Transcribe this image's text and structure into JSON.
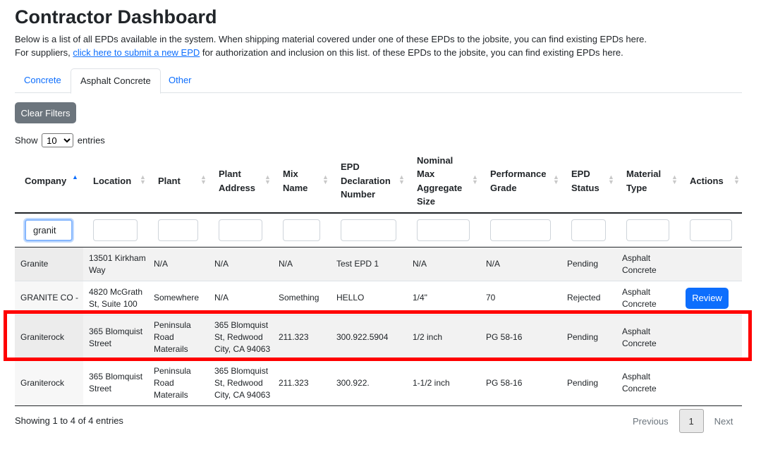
{
  "header": {
    "title": "Contractor Dashboard",
    "desc_line1": "Below is a list of all EPDs available in the system. When shipping material covered under one of these EPDs to the jobsite, you can find existing EPDs here.",
    "desc_line2_pre": "For suppliers, ",
    "desc_link": "click here to submit a new EPD",
    "desc_line2_post": " for authorization and inclusion on this list. of these EPDs to the jobsite, you can find existing EPDs here."
  },
  "tabs": [
    {
      "label": "Concrete",
      "active": false
    },
    {
      "label": "Asphalt Concrete",
      "active": true
    },
    {
      "label": "Other",
      "active": false
    }
  ],
  "toolbar": {
    "clear_filters": "Clear Filters",
    "show_label": "Show",
    "entries_value": "10",
    "entries_label": "entries"
  },
  "columns": [
    {
      "label": "Company",
      "sorted": "asc"
    },
    {
      "label": "Location"
    },
    {
      "label": "Plant"
    },
    {
      "label": "Plant Address"
    },
    {
      "label": "Mix Name"
    },
    {
      "label": "EPD Declaration Number"
    },
    {
      "label": "Nominal Max Aggregate Size"
    },
    {
      "label": "Performance Grade"
    },
    {
      "label": "EPD Status"
    },
    {
      "label": "Material Type"
    },
    {
      "label": "Actions"
    }
  ],
  "filters": {
    "company_value": "granit"
  },
  "rows": [
    {
      "company": "Granite",
      "location": "13501 Kirkham Way",
      "plant": "N/A",
      "plant_address": "N/A",
      "mix_name": "N/A",
      "epd_number": "Test EPD 1",
      "max_agg": "N/A",
      "grade": "N/A",
      "status": "Pending",
      "material": "Asphalt Concrete",
      "action": ""
    },
    {
      "company": "GRANITE CO -",
      "location": "4820 McGrath St, Suite 100",
      "plant": "Somewhere",
      "plant_address": "N/A",
      "mix_name": "Something",
      "epd_number": "HELLO",
      "max_agg": "1/4\"",
      "grade": "70",
      "status": "Rejected",
      "material": "Asphalt Concrete",
      "action": "Review"
    },
    {
      "company": "Graniterock",
      "location": "365 Blomquist Street",
      "plant": "Peninsula Road Materails",
      "plant_address": "365 Blomquist St, Redwood City, CA 94063",
      "mix_name": "211.323",
      "epd_number": "300.922.5904",
      "max_agg": "1/2 inch",
      "grade": "PG 58-16",
      "status": "Pending",
      "material": "Asphalt Concrete",
      "action": ""
    },
    {
      "company": "Graniterock",
      "location": "365 Blomquist Street",
      "plant": "Peninsula Road Materails",
      "plant_address": "365 Blomquist St, Redwood City, CA 94063",
      "mix_name": "211.323",
      "epd_number": "300.922.",
      "max_agg": "1-1/2 inch",
      "grade": "PG 58-16",
      "status": "Pending",
      "material": "Asphalt Concrete",
      "action": ""
    }
  ],
  "footer": {
    "info": "Showing 1 to 4 of 4 entries",
    "previous": "Previous",
    "page": "1",
    "next": "Next"
  },
  "colors": {
    "link": "#0d6efd",
    "highlight": "#ff0000",
    "button_gray": "#6c757d",
    "button_primary": "#0d6efd"
  }
}
